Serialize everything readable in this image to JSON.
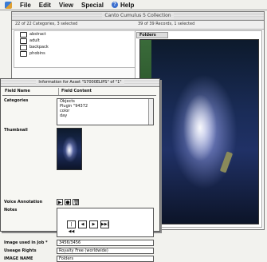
{
  "menubar": {
    "items": [
      "File",
      "Edit",
      "View",
      "Special",
      "Help"
    ]
  },
  "catalog_window": {
    "title": "Canto Cumulus 5 Collection",
    "category_status": "22 of 22 Categories, 3 selected",
    "record_status": "39 of 39 Records, 1 selected",
    "categories": [
      "abstract",
      "adult",
      "backpack",
      "phobins"
    ],
    "record_field_tab": "Folders"
  },
  "info_dialog": {
    "title": "Information for Asset \"S7000ELIPS\" of \"1\"",
    "headers": {
      "field_name": "Field Name",
      "field_content": "Field Content"
    },
    "fields": {
      "categories_label": "Categories",
      "categories_values": [
        "Objects",
        "Plugin \"94372",
        "color",
        "day"
      ],
      "thumbnail_label": "Thumbnail",
      "voice_annotation_label": "Voice Annotation",
      "notes_label": "Notes",
      "image_used_label": "Image used in Job *",
      "image_used_value": "3456/3456",
      "usage_rights_label": "Useage Rights",
      "usage_rights_value": "Royalty Free (worldwide)",
      "image_name_label": "IMAGE NAME",
      "image_name_value": "Folders"
    }
  },
  "navigation": {
    "first": "|◀◀",
    "prev": "◀",
    "next": "▶",
    "last": "▶▶|"
  }
}
